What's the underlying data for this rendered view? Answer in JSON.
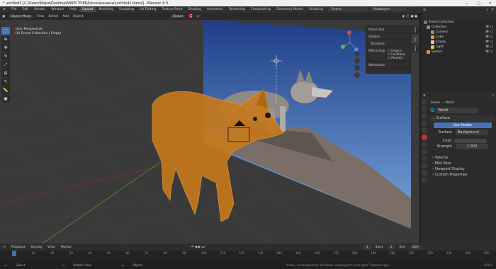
{
  "window": {
    "title": "* untitled2 [C:\\Users\\Маря\\Desktop\\МАРК УЧЕБА\\ели\\машины\\untitled2.blend] - Blender 4.0",
    "min": "—",
    "max": "▢",
    "close": "✕"
  },
  "menu": {
    "items": [
      "File",
      "Edit",
      "Render",
      "Window",
      "Help"
    ],
    "workspaces": [
      "Layout",
      "Modeling",
      "Sculpting",
      "UV Editing",
      "Texture Paint",
      "Shading",
      "Animation",
      "Rendering",
      "Compositing",
      "Geometry Nodes",
      "Scripting"
    ],
    "active_workspace": "Layout",
    "scene": "Scene",
    "view_layer": "ViewLayer"
  },
  "viewport_header": {
    "mode": "Object Mode",
    "menus": [
      "View",
      "Select",
      "Add",
      "Object"
    ],
    "orientation": "Global",
    "options": "Options"
  },
  "viewport": {
    "view_name": "User Perspective",
    "collection_info": "(0) Scene Collection | Empty"
  },
  "tools": [
    "cursor-select",
    "cursor",
    "move",
    "rotate",
    "scale",
    "transform",
    "annotate",
    "measure",
    "add-cube"
  ],
  "npanel": {
    "active_tool": "Active Tool",
    "options": "Options",
    "transform": "Transform",
    "affect_only": "Affect Only",
    "origins": "Origins",
    "locations": "Locations",
    "parents": "Parents",
    "workspace": "Workspace",
    "tabs": [
      "Item",
      "Tool",
      "View"
    ]
  },
  "outliner": {
    "title": "Scene Collection",
    "items": [
      {
        "name": "Collection",
        "color": "#8a8a8a"
      },
      {
        "name": "Camera",
        "color": "#6fa86f"
      },
      {
        "name": "Cube",
        "color": "#e09a3a"
      },
      {
        "name": "Empty",
        "color": "#cfcfcf"
      },
      {
        "name": "Light",
        "color": "#e0c44a"
      },
      {
        "name": "Sphere",
        "color": "#e09a3a"
      }
    ]
  },
  "properties": {
    "scene": "Scene",
    "world_tab": "World",
    "world_name": "World",
    "surface_section": "Surface",
    "use_nodes": "Use Nodes",
    "surface_label": "Surface",
    "surface_value": "Background",
    "color_label": "Color",
    "strength_label": "Strength",
    "strength_value": "1.000",
    "sections": [
      "Volume",
      "Mist Pass",
      "Viewport Display",
      "Custom Properties"
    ]
  },
  "timeline": {
    "menus": [
      "Playback",
      "Keying",
      "View",
      "Marker"
    ],
    "start_label": "Start",
    "start": "1",
    "end_label": "End",
    "end": "250",
    "current": "1",
    "ticks": [
      "0",
      "10",
      "20",
      "30",
      "40",
      "50",
      "60",
      "70",
      "80",
      "90",
      "100",
      "110",
      "120",
      "130",
      "140",
      "150",
      "160",
      "170",
      "180",
      "190",
      "200",
      "210",
      "220",
      "230",
      "240",
      "250"
    ]
  },
  "statusbar": {
    "select": "Select",
    "rotate_view": "Rotate View",
    "object": "Object",
    "activation": "Чтобы активировать Windows, перейдите в раздел \"Параметры\".",
    "version": "4.0.2"
  },
  "colors": {
    "accent": "#4772b3",
    "fox": "#c87a1a",
    "sky_top": "#1e3d86",
    "sky_bottom": "#6f9ed8"
  }
}
